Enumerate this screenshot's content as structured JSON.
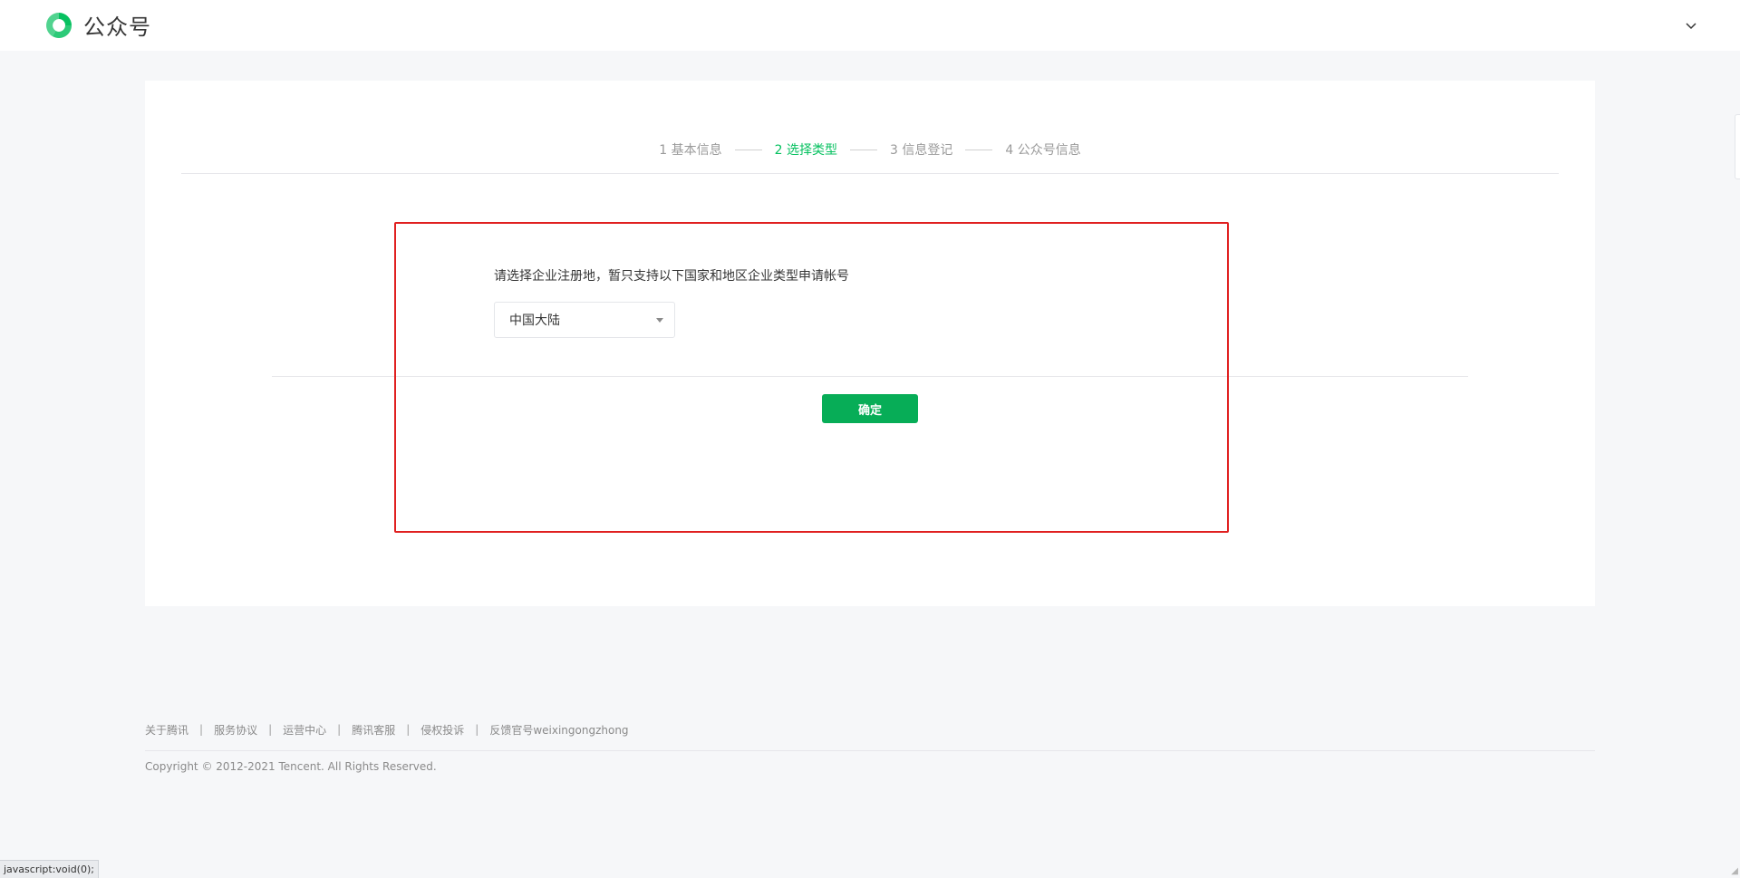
{
  "header": {
    "app_name": "公众号"
  },
  "steps": [
    {
      "label": "1 基本信息",
      "active": false
    },
    {
      "label": "2 选择类型",
      "active": true
    },
    {
      "label": "3 信息登记",
      "active": false
    },
    {
      "label": "4 公众号信息",
      "active": false
    }
  ],
  "form": {
    "prompt": "请选择企业注册地，暂只支持以下国家和地区企业类型申请帐号",
    "region_select_value": "中国大陆",
    "confirm_label": "确定"
  },
  "footer": {
    "links": [
      "关于腾讯",
      "服务协议",
      "运营中心",
      "腾讯客服",
      "侵权投诉",
      "反馈官号weixingongzhong"
    ],
    "separator": "|",
    "copyright": "Copyright © 2012-2021 Tencent. All Rights Reserved."
  },
  "statusbar": {
    "text": "javascript:void(0);"
  },
  "colors": {
    "brand_green": "#07c160",
    "button_green": "#07ad57",
    "highlight_red": "#e02020"
  },
  "icons": {
    "logo": "wechat-official-account-logo-icon",
    "account_menu": "chevron-down-icon",
    "select_caret": "caret-down-icon"
  }
}
